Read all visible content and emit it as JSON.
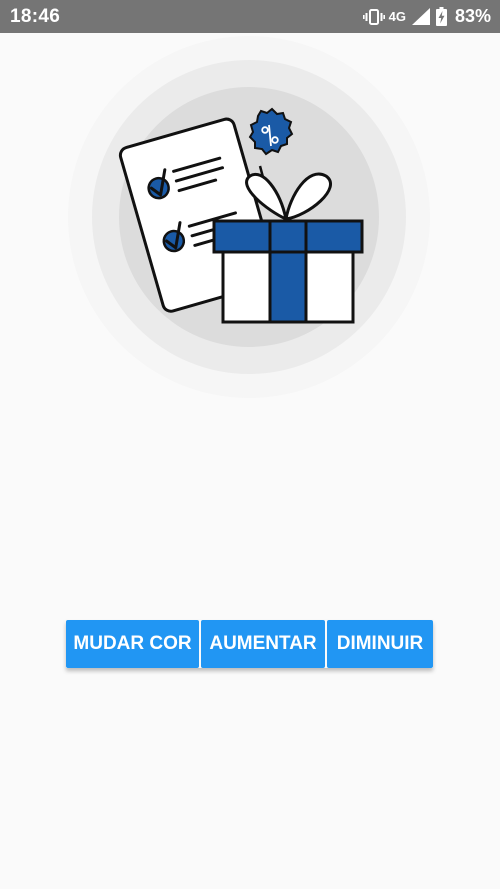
{
  "status_bar": {
    "time": "18:46",
    "network": "4G",
    "battery": "83%",
    "icons": [
      "vibrate-icon",
      "signal-icon",
      "battery-charging-icon"
    ]
  },
  "illustration": {
    "badge_symbol": "%",
    "description_icons": [
      "checklist-icon",
      "gift-box-icon",
      "discount-badge-icon"
    ]
  },
  "buttons": {
    "change_color": "MUDAR COR",
    "increase": "AUMENTAR",
    "decrease": "DIMINUIR"
  },
  "colors": {
    "status_bar_bg": "#757575",
    "background": "#fafafa",
    "button_bg": "#2196f3",
    "button_text": "#ffffff",
    "accent_blue": "#1a5aa6"
  }
}
